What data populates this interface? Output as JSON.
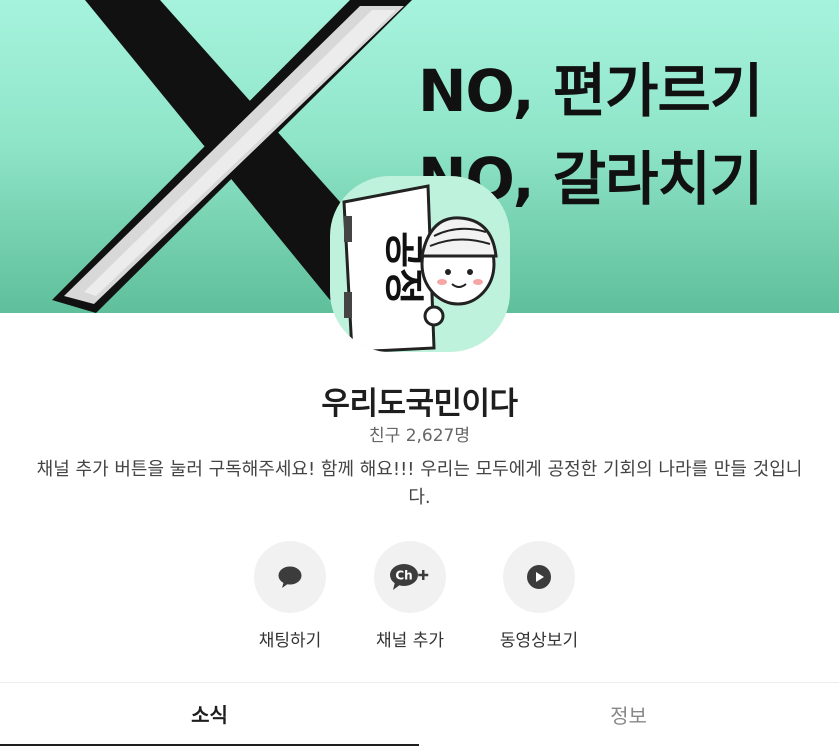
{
  "banner": {
    "line1": "NO, 편가르기",
    "line2": "NO, 갈라치기"
  },
  "avatar": {
    "sign_text": "공정"
  },
  "channel": {
    "name": "우리도국민이다",
    "friends_label": "친구",
    "friends_count": "2,627명",
    "description": "채널 추가 버튼을 눌러 구독해주세요! 함께 해요!!! 우리는 모두에게 공정한 기회의 나라를 만들 것입니다."
  },
  "actions": [
    {
      "label": "채팅하기",
      "icon": "chat-bubble-icon"
    },
    {
      "label": "채널 추가",
      "icon": "channel-add-icon",
      "icon_text": "Ch"
    },
    {
      "label": "동영상보기",
      "icon": "play-icon"
    }
  ],
  "tabs": [
    {
      "label": "소식",
      "active": true
    },
    {
      "label": "정보",
      "active": false
    }
  ],
  "colors": {
    "banner_top": "#a6f3dd",
    "banner_bottom": "#5fbf9b",
    "icon_dark": "#3c3c3c",
    "action_bg": "#f1f1f1"
  }
}
